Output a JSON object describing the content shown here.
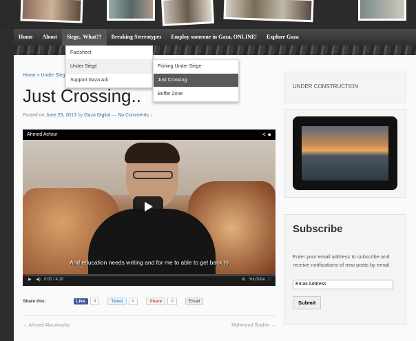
{
  "nav": {
    "items": [
      "Home",
      "About",
      "Siege.. What??",
      "Breaking Stereotypes",
      "Employ someone in Gaza, ONLINE!",
      "Explore Gaza"
    ]
  },
  "menu": {
    "level1": [
      "Factsheet",
      "Under Siege",
      "Support Gaza Ark"
    ],
    "level2": [
      "Fishing Under Siege",
      "Just Crossing",
      "Buffer Zone"
    ]
  },
  "post": {
    "breadcrumb": "Home » Under Siege",
    "title": "Just Crossing..",
    "meta_prefix": "Posted on",
    "date": "June 29, 2013",
    "by": "by",
    "author": "Gaza Digital",
    "sep": "—",
    "comments": "No Comments ↓"
  },
  "video": {
    "channel": "Ahmed Aefour",
    "subtitle": "And education needs writing and for me to able to get back to",
    "time": "0:00 / 4:10",
    "progress": 0.01,
    "youtube_label": "YouTube"
  },
  "share": {
    "label": "Share this:",
    "like": "Like",
    "like_count": "0",
    "tweet": "Tweet",
    "tweet_count": "0",
    "gplus": "Share",
    "gplus_count": "0",
    "email": "Email"
  },
  "postnav": {
    "prev": "←  Ahmed Abu Amsha",
    "next": "Mahmoud Shahin  →"
  },
  "sidebar": {
    "under_construction": "UNDER CONSTRUCTION",
    "subscribe_title": "Subscribe",
    "subscribe_text": "Enter your email address to subscribe and receive notifications of new posts by email.",
    "email_placeholder": "Email Address",
    "submit": "Submit"
  }
}
